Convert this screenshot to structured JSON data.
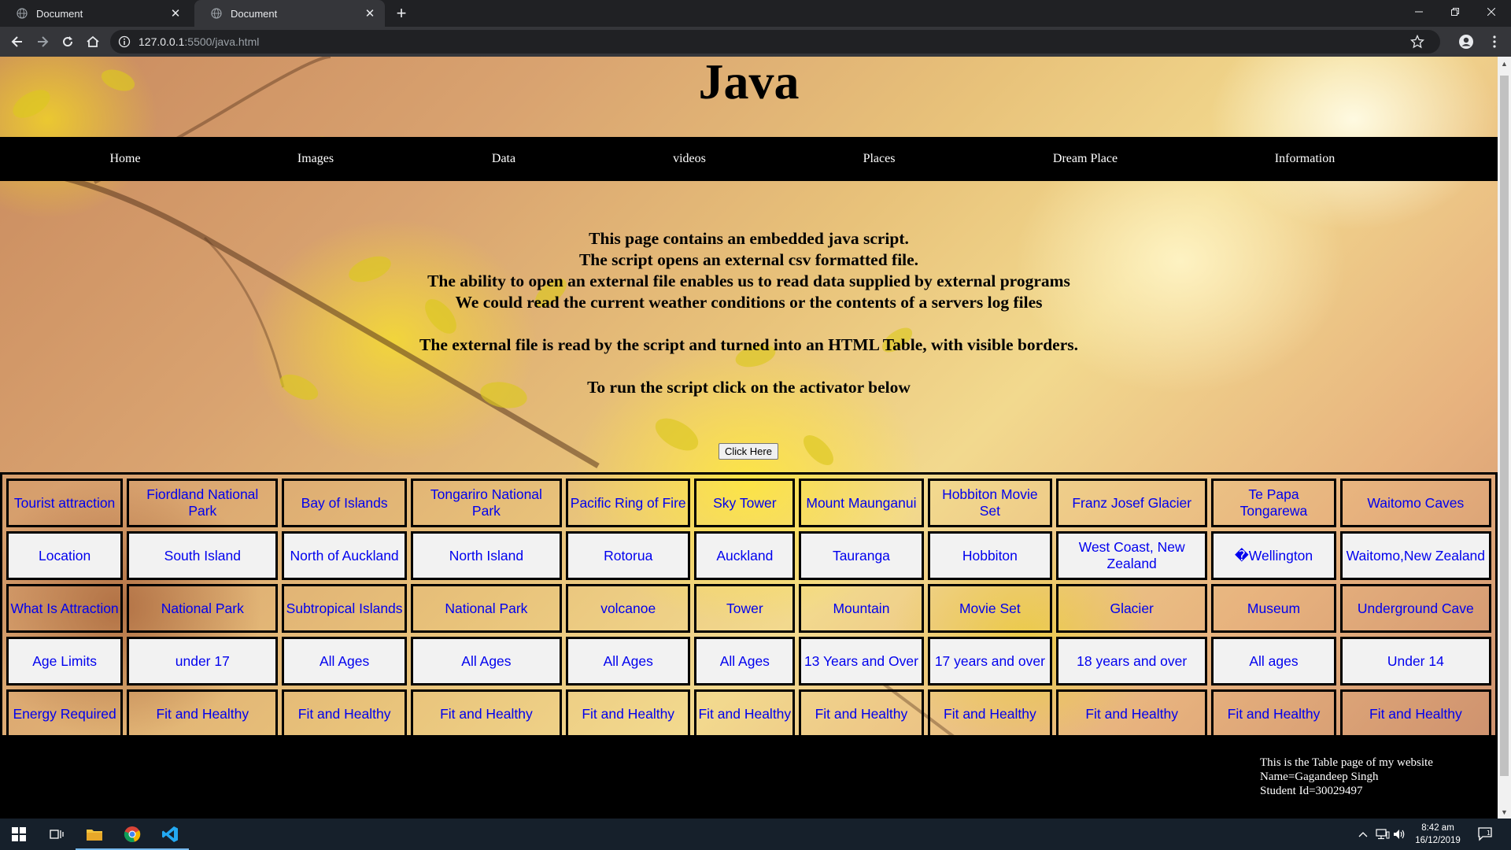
{
  "browser": {
    "tabs": [
      {
        "title": "Document",
        "active": false
      },
      {
        "title": "Document",
        "active": true
      }
    ],
    "url_host": "127.0.0.1",
    "url_path": ":5500/java.html"
  },
  "page": {
    "heading": "Java",
    "nav": [
      "Home",
      "Images",
      "Data",
      "videos",
      "Places",
      "Dream Place",
      "Information"
    ],
    "intro": [
      "This page contains an embedded java script.",
      "The script opens an external csv formatted file.",
      "The ability to open an external file enables us to read data supplied by external programs",
      "We could read the current weather conditions or the contents of a servers log files",
      "",
      "The external file is read by the script and turned into an HTML Table, with visible borders.",
      "",
      "To run the script click on the activator below"
    ],
    "button_label": "Click Here",
    "table": [
      [
        "Tourist attraction",
        "Fiordland National Park",
        "Bay of Islands",
        "Tongariro National Park",
        "Pacific Ring of Fire",
        "Sky Tower",
        "Mount Maunganui",
        "Hobbiton Movie Set",
        "Franz Josef Glacier",
        "Te Papa Tongarewa",
        "Waitomo Caves"
      ],
      [
        "Location",
        "South Island",
        "North of Auckland",
        "North Island",
        "Rotorua",
        "Auckland",
        "Tauranga",
        "Hobbiton",
        "West Coast, New Zealand",
        "�Wellington",
        "Waitomo,New Zealand"
      ],
      [
        "What Is Attraction",
        "National Park",
        "Subtropical Islands",
        "National Park",
        "volcanoe",
        "Tower",
        "Mountain",
        "Movie Set",
        "Glacier",
        "Museum",
        "Underground Cave"
      ],
      [
        "Age Limits",
        "under 17",
        "All Ages",
        "All Ages",
        "All Ages",
        "All Ages",
        "13 Years and Over",
        "17 years and over",
        "18 years and over",
        "All ages",
        "Under 14"
      ],
      [
        "Energy Required",
        "Fit and Healthy",
        "Fit and Healthy",
        "Fit and Healthy",
        "Fit and Healthy",
        "Fit and Healthy",
        "Fit and Healthy",
        "Fit and Healthy",
        "Fit and Healthy",
        "Fit and Healthy",
        "Fit and Healthy"
      ]
    ],
    "footer": [
      "This is the Table page of my website",
      "Name=Gagandeep Singh",
      "Student Id=30029497"
    ]
  },
  "taskbar": {
    "time": "8:42 am",
    "date": "16/12/2019",
    "notifications": "1"
  },
  "colors": {
    "link_blue": "#0000ee",
    "nav_bg": "#000000",
    "chrome_dark": "#202124",
    "chrome_toolbar": "#35363a"
  }
}
